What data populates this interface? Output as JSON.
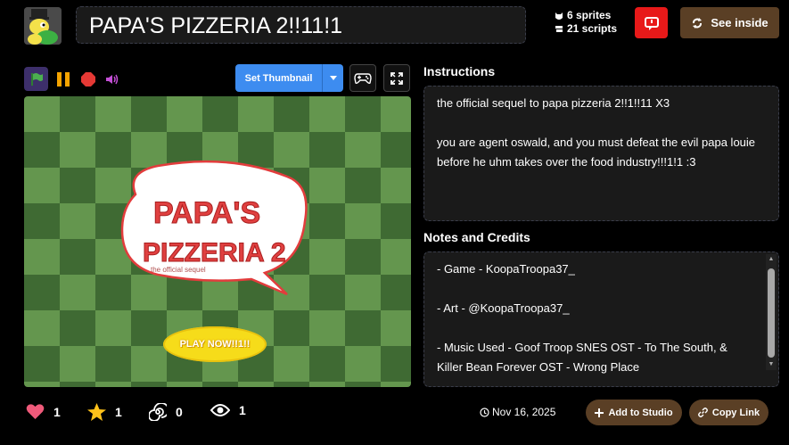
{
  "header": {
    "project_title": "PAPA'S PIZZERIA 2!!11!1",
    "sprites": "6 sprites",
    "scripts": "21 scripts",
    "see_inside_label": "See inside"
  },
  "player": {
    "thumbnail_label": "Set Thumbnail",
    "logo_line1": "PAPA'S",
    "logo_line2": "PIZZERIA 2",
    "logo_sub": "the official sequel",
    "play_button": "PLAY NOW!!1!!"
  },
  "instructions": {
    "title": "Instructions",
    "line1": "the official sequel to papa pizzeria 2!!1!!11 X3",
    "line2": "you are agent oswald, and you must defeat the evil papa louie before he uhm takes over the food industry!!!1!1 :3"
  },
  "notes": {
    "title": "Notes and Credits",
    "line1": "- Game - KoopaTroopa37_",
    "line2": "- Art - @KoopaTroopa37_",
    "line3": "- Music Used - Goof Troop SNES  OST - To The South, & Killer Bean Forever OST - Wrong Place"
  },
  "footer": {
    "loves": "1",
    "favorites": "1",
    "remixes": "0",
    "views": "1",
    "date": "Nov 16, 2025",
    "add_studio": "Add to Studio",
    "copy_link": "Copy Link"
  },
  "colors": {
    "accent_blue": "#3d8cf0",
    "brown_button": "#5a3f25",
    "report_red": "#e81919",
    "stage_dark": "#3f6a33",
    "stage_light": "#64964e"
  }
}
